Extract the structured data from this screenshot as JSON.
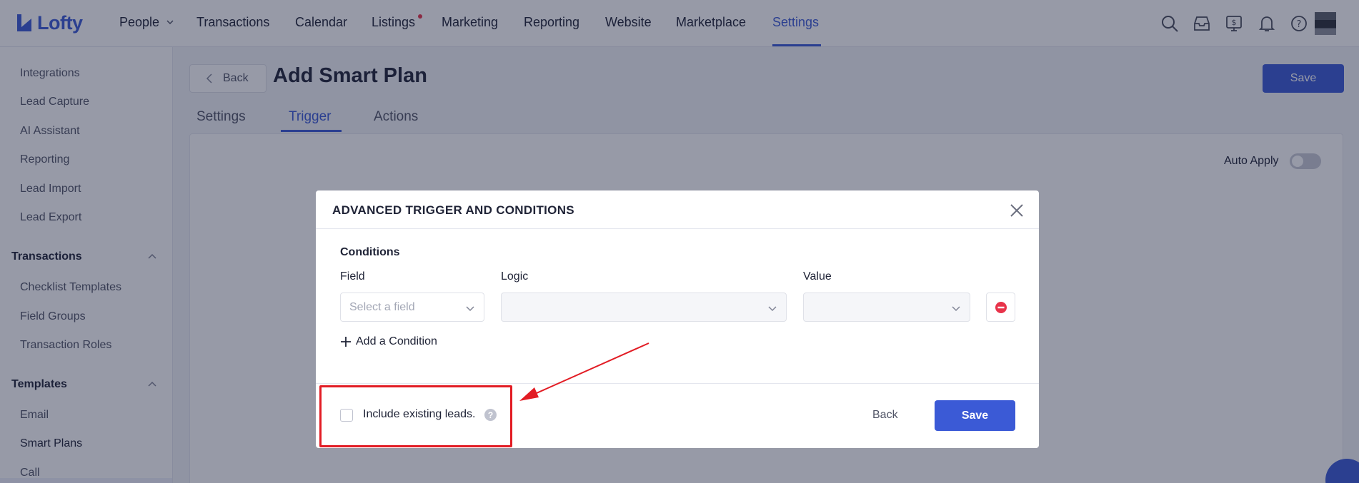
{
  "brand": {
    "name": "Lofty",
    "accent": "#3b5ad6"
  },
  "nav": {
    "items": [
      {
        "label": "People"
      },
      {
        "label": "Transactions"
      },
      {
        "label": "Calendar"
      },
      {
        "label": "Listings"
      },
      {
        "label": "Marketing"
      },
      {
        "label": "Reporting"
      },
      {
        "label": "Website"
      },
      {
        "label": "Marketplace"
      },
      {
        "label": "Settings"
      }
    ],
    "active": "Settings",
    "icons": [
      "search-icon",
      "inbox-icon",
      "dollar-screen-icon",
      "bell-icon",
      "help-icon",
      "avatar"
    ]
  },
  "sidebar": {
    "items_top": [
      "Integrations",
      "Lead Capture",
      "AI Assistant",
      "Reporting",
      "Lead Import",
      "Lead Export"
    ],
    "sections": [
      {
        "title": "Transactions",
        "items": [
          "Checklist Templates",
          "Field Groups",
          "Transaction Roles"
        ]
      },
      {
        "title": "Templates",
        "items": [
          "Email",
          "Smart Plans",
          "Call"
        ]
      }
    ],
    "active": "Smart Plans"
  },
  "page": {
    "back_label": "Back",
    "title": "Add Smart Plan",
    "save_label": "Save",
    "tabs": [
      "Settings",
      "Trigger",
      "Actions"
    ],
    "active_tab": "Trigger",
    "auto_apply_label": "Auto Apply"
  },
  "modal": {
    "title": "ADVANCED TRIGGER AND CONDITIONS",
    "conditions_title": "Conditions",
    "columns": {
      "field": "Field",
      "logic": "Logic",
      "value": "Value"
    },
    "field_placeholder": "Select a field",
    "add_condition_label": "Add a Condition",
    "include_existing_label": "Include existing leads.",
    "help_glyph": "?",
    "back_label": "Back",
    "save_label": "Save"
  }
}
